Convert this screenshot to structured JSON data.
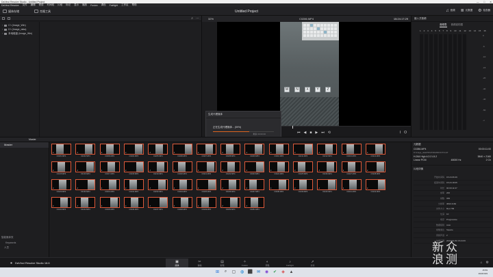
{
  "window": {
    "title": "DaVinci Resolve Studio - Untitled Project",
    "controls": [
      "—",
      "□",
      "✕"
    ]
  },
  "menu": [
    "DaVinci Resolve",
    "文件",
    "编辑",
    "修剪",
    "时间线",
    "片段",
    "标记",
    "显示",
    "播放",
    "Fusion",
    "调色",
    "Fairlight",
    "工作区",
    "帮助"
  ],
  "toolbar": {
    "media_storage": "媒体存储",
    "clone": "克隆工具",
    "project_title": "Untitled Project",
    "right_items": [
      {
        "icon": "music-icon",
        "glyph": "♫",
        "label": "音频"
      },
      {
        "icon": "metadata-icon",
        "glyph": "≣",
        "label": "元数据"
      },
      {
        "icon": "inspector-icon",
        "glyph": "⚙",
        "label": "检查器"
      }
    ]
  },
  "media_storage": {
    "volumes": [
      "C:\\ (Image_Win)",
      "D:\\ (Image_data)",
      "本地磁盘 (Image_Win)"
    ]
  },
  "viewer": {
    "zoom": "32%",
    "clip_name": "C0286.MP4",
    "timecode": "15:24:17:29",
    "keycaps": [
      "M",
      "N",
      "X",
      "Y",
      "Z"
    ]
  },
  "transport": {
    "buttons": [
      "⏮",
      "◀",
      "■",
      "▶",
      "⏭",
      "⟲"
    ],
    "right_buttons": [
      "I",
      "O"
    ]
  },
  "dialog": {
    "title": "生成代理媒体",
    "message": "正在生成代理媒体... (59%)",
    "progress": 0.59,
    "sub": "剩余 00:00:00",
    "cancel": "取消",
    "accent": "#e0641e"
  },
  "audio_meters": {
    "header": "嵌入式音频",
    "tabs": [
      "音频表",
      "音频波形图"
    ],
    "active_tab": 0,
    "channels": [
      "1",
      "2",
      "3",
      "4",
      "5",
      "6",
      "7",
      "8",
      "9",
      "10",
      "11",
      "12",
      "13",
      "14",
      "15",
      "16"
    ],
    "scale": [
      "0",
      "-5",
      "-10",
      "-15",
      "-20",
      "-30",
      "-40",
      "-50",
      "-∞"
    ]
  },
  "bin": {
    "header_master": "Master",
    "sidebar_master": "Master",
    "smart_bins_header": "智能媒体夹",
    "smart_bins": [
      "Keywords",
      "人员"
    ],
    "clips": [
      "C0201.MP4",
      "C0202.MP4",
      "C0203.MP4",
      "C0204.MP4",
      "C0205.MP4",
      "C0206.MP4",
      "C0207.MP4",
      "C0208.MP4",
      "C0209.MP4",
      "C0210.MP4",
      "C0211.MP4",
      "C0212.MP4",
      "C0213.MP4",
      "C0214.MP4",
      "C0215.MP4",
      "C0216.MP4",
      "C0217.MP4",
      "C0218.MP4",
      "C0219.MP4",
      "C0220.MP4",
      "C0221.MP4",
      "C0222.MP4",
      "C0223.MP4",
      "C0224.MP4",
      "C0225.MP4",
      "C0226.MP4",
      "C0227.MP4",
      "C0228.MP4",
      "C0229.MP4",
      "C0230.MP4",
      "C0231.MP4",
      "C0232.MP4",
      "C0233.MP4",
      "C0234.MP4",
      "C0235.MP4",
      "C0236.MP4",
      "C0237.MP4",
      "C0238.MP4",
      "C0239.MP4",
      "C0240.MP4",
      "C0241.MP4",
      "C0242.MP4",
      "C0243.MP4",
      "C0244.MP4",
      "C0245.MP4",
      "C0246.MP4",
      "C0247.MP4",
      "C0248.MP4",
      "C0249.MP4",
      "C0250.MP4",
      "C0251.MP4"
    ],
    "clip_border_color": "#e05a3a"
  },
  "clip_info": {
    "header": "元数据",
    "clip_name": "C0286.MP4",
    "clip_duration": "00:00:11:00",
    "clip_path": "D:\\Image_data\\PRIVATE\\M4ROOT\\CLIP",
    "video_codec": "H.264 High 4:2:2 L5.2",
    "video_format": "3840 × 2160",
    "audio_codec": "Linear PCM",
    "audio_format": "48000 Hz",
    "audio_ch": "2 Ch",
    "section": "片段详情",
    "rows": [
      {
        "k": "开始时间码",
        "v": "15:24:06:29"
      },
      {
        "k": "结束时间码",
        "v": "15:24:18:05"
      },
      {
        "k": "时长",
        "v": "00:00:11:07"
      },
      {
        "k": "帧率",
        "v": "200"
      },
      {
        "k": "帧数",
        "v": "339"
      },
      {
        "k": "分辨率",
        "v": "3840 2160"
      },
      {
        "k": "文件大小",
        "v": "Rec.709"
      },
      {
        "k": "位深",
        "v": "10"
      },
      {
        "k": "场序",
        "v": "Progressive"
      },
      {
        "k": "数据级别",
        "v": "Auto"
      },
      {
        "k": "帧像素比",
        "v": "Square"
      },
      {
        "k": "音频声道",
        "v": "2"
      },
      {
        "k": "拍摄日期",
        "v": "2024-03-09 15:24:06"
      }
    ]
  },
  "pages": {
    "brand": "DaVinci Resolve Studio 18.6",
    "tabs": [
      {
        "icon": "media-page-icon",
        "glyph": "▣",
        "label": "媒体"
      },
      {
        "icon": "cut-page-icon",
        "glyph": "✂",
        "label": "快编"
      },
      {
        "icon": "edit-page-icon",
        "glyph": "▤",
        "label": "剪辑"
      },
      {
        "icon": "fusion-page-icon",
        "glyph": "✧",
        "label": "Fusion"
      },
      {
        "icon": "color-page-icon",
        "glyph": "◐",
        "label": "调色"
      },
      {
        "icon": "fairlight-page-icon",
        "glyph": "♪",
        "label": "Fairlight"
      },
      {
        "icon": "deliver-page-icon",
        "glyph": "➚",
        "label": "交付"
      }
    ],
    "active": 0,
    "right_icons": [
      "⌂",
      "⚙"
    ]
  },
  "taskbar": {
    "apps": [
      "⊞",
      "⌕",
      "▢",
      "◍",
      "⬛",
      "✉",
      "◉",
      "✔",
      "◈",
      "▲"
    ],
    "time": "15:59",
    "date": "2024/3/29"
  },
  "watermark": {
    "line1": "新",
    "line2": "浪",
    "line3": "众",
    "line4": "测"
  }
}
